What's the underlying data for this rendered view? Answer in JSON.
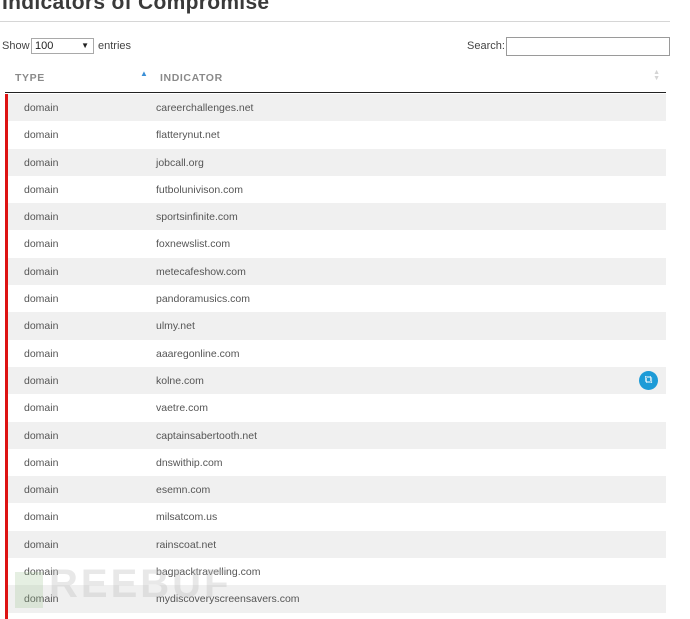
{
  "page": {
    "title": "Indicators of Compromise"
  },
  "controls": {
    "show_label": "Show",
    "length_value": "100",
    "entries_label": "entries",
    "search_label": "Search:",
    "search_value": ""
  },
  "table": {
    "headers": {
      "type": "TYPE",
      "indicator": "INDICATOR"
    },
    "rows": [
      {
        "type": "domain",
        "indicator": "careerchallenges.net"
      },
      {
        "type": "domain",
        "indicator": "flatterynut.net"
      },
      {
        "type": "domain",
        "indicator": "jobcall.org"
      },
      {
        "type": "domain",
        "indicator": "futbolunivison.com"
      },
      {
        "type": "domain",
        "indicator": "sportsinfinite.com"
      },
      {
        "type": "domain",
        "indicator": "foxnewslist.com"
      },
      {
        "type": "domain",
        "indicator": "metecafeshow.com"
      },
      {
        "type": "domain",
        "indicator": "pandoramusics.com"
      },
      {
        "type": "domain",
        "indicator": "ulmy.net"
      },
      {
        "type": "domain",
        "indicator": "aaaregonline.com"
      },
      {
        "type": "domain",
        "indicator": "kolne.com"
      },
      {
        "type": "domain",
        "indicator": "vaetre.com"
      },
      {
        "type": "domain",
        "indicator": "captainsabertooth.net"
      },
      {
        "type": "domain",
        "indicator": "dnswithip.com"
      },
      {
        "type": "domain",
        "indicator": "esemn.com"
      },
      {
        "type": "domain",
        "indicator": "milsatcom.us"
      },
      {
        "type": "domain",
        "indicator": "rainscoat.net"
      },
      {
        "type": "domain",
        "indicator": "bagpacktravelling.com"
      },
      {
        "type": "domain",
        "indicator": "mydiscoveryscreensavers.com"
      }
    ],
    "hovered_row_copy_icon": "copy-icon"
  },
  "watermark": {
    "text": "REEBUF"
  },
  "colors": {
    "accent": "#dd1313",
    "copy_button": "#1d9bd7",
    "sort_active": "#3b8fd6"
  }
}
